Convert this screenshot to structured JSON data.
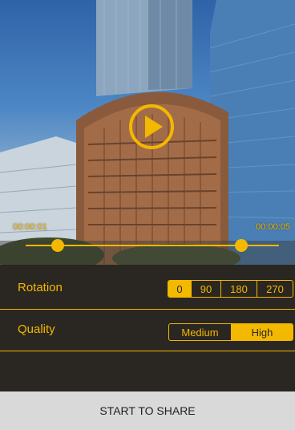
{
  "player": {
    "current_time": "00:00:01",
    "end_time": "00:00:05",
    "play_icon": "play-icon"
  },
  "settings": {
    "rotation": {
      "label": "Rotation",
      "options": [
        "0",
        "90",
        "180",
        "270"
      ],
      "selected": "0"
    },
    "quality": {
      "label": "Quality",
      "options": [
        "Medium",
        "High"
      ],
      "selected": "High"
    }
  },
  "actions": {
    "share_label": "START TO SHARE"
  },
  "colors": {
    "accent": "#f3b800",
    "panel_bg": "#2a2622",
    "button_bg": "#d9d9d9"
  }
}
